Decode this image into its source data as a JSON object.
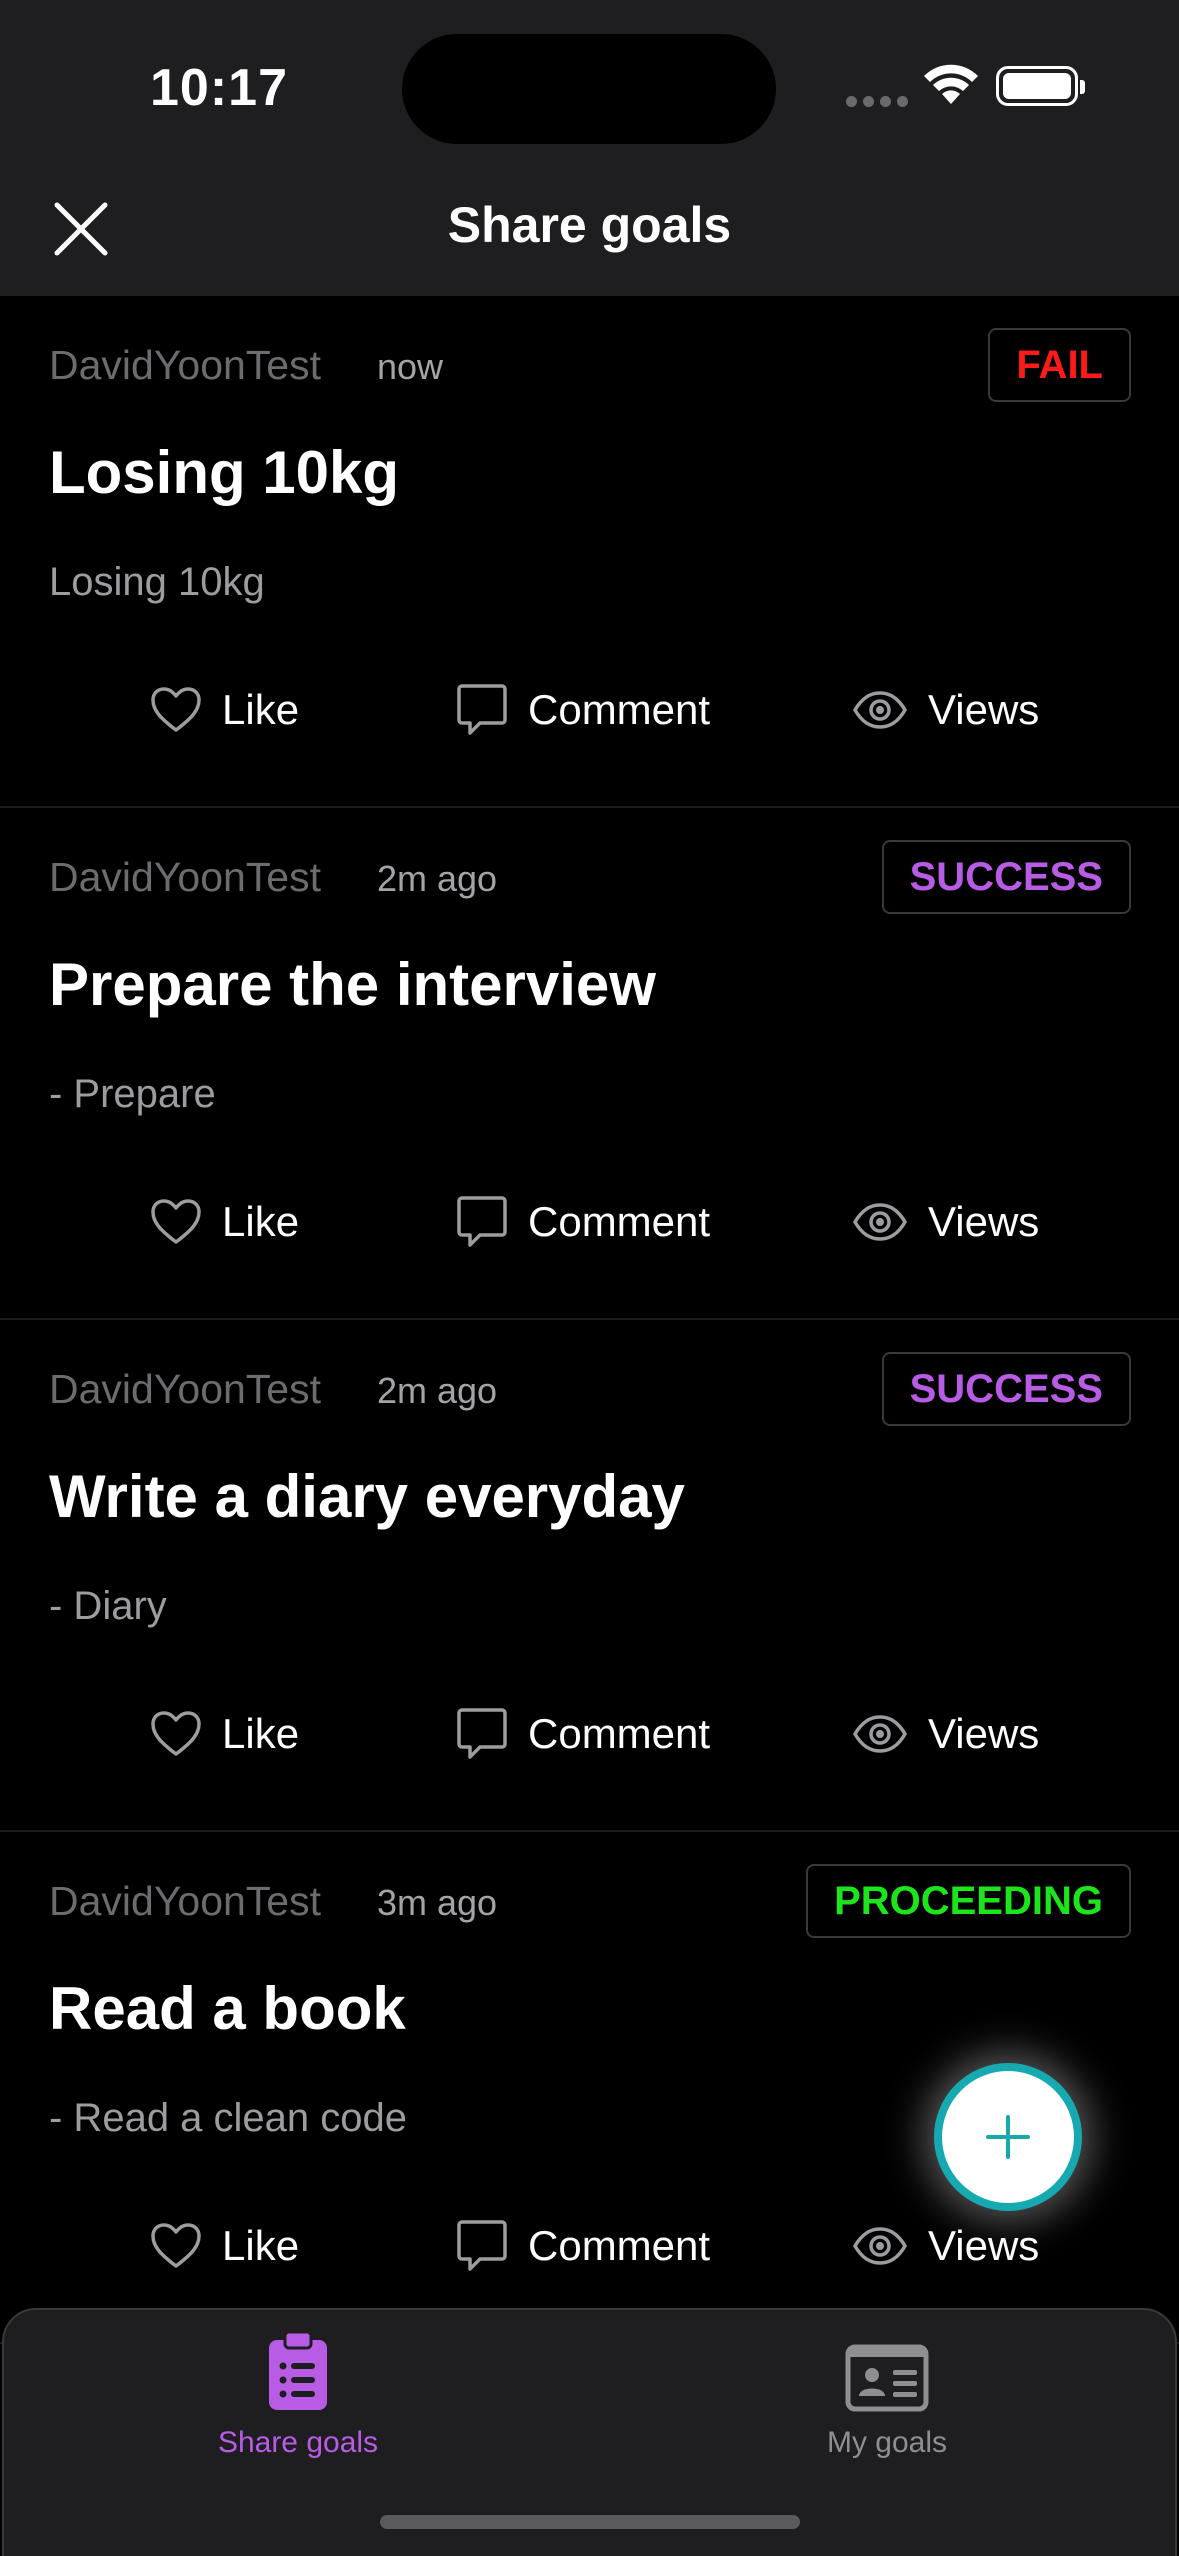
{
  "status_bar": {
    "time": "10:17"
  },
  "header": {
    "title": "Share goals"
  },
  "actions": {
    "like": "Like",
    "comment": "Comment",
    "views": "Views"
  },
  "posts": [
    {
      "author": "DavidYoonTest",
      "time": "now",
      "status": "FAIL",
      "status_color": "#ff1a1a",
      "title": "Losing 10kg",
      "description": "Losing 10kg"
    },
    {
      "author": "DavidYoonTest",
      "time": "2m ago",
      "status": "SUCCESS",
      "status_color": "#b85ce6",
      "title": "Prepare the interview",
      "description": "- Prepare"
    },
    {
      "author": "DavidYoonTest",
      "time": "2m ago",
      "status": "SUCCESS",
      "status_color": "#b85ce6",
      "title": "Write a diary everyday",
      "description": "- Diary"
    },
    {
      "author": "DavidYoonTest",
      "time": "3m ago",
      "status": "PROCEEDING",
      "status_color": "#1be61b",
      "title": "Read a book",
      "description": "- Read a clean code"
    }
  ],
  "fab": {
    "icon": "plus-icon",
    "color": "#17a9b0"
  },
  "tabbar": {
    "items": [
      {
        "label": "Share goals",
        "icon": "clipboard-list-icon",
        "active": true,
        "color": "#b85ce6"
      },
      {
        "label": "My goals",
        "icon": "id-card-icon",
        "active": false,
        "color": "#8e8e93"
      }
    ]
  }
}
